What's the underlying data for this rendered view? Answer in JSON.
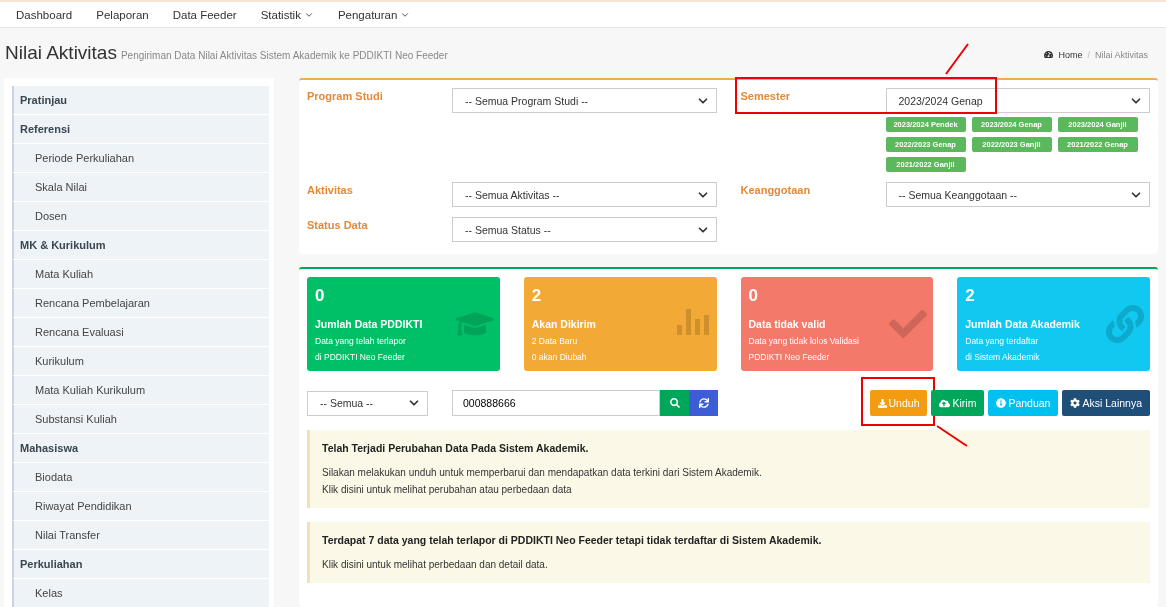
{
  "nav": [
    {
      "label": "Dashboard",
      "dropdown": false
    },
    {
      "label": "Pelaporan",
      "dropdown": false
    },
    {
      "label": "Data Feeder",
      "dropdown": false
    },
    {
      "label": "Statistik",
      "dropdown": true
    },
    {
      "label": "Pengaturan",
      "dropdown": true
    }
  ],
  "header": {
    "title": "Nilai Aktivitas",
    "subtitle": "Pengiriman Data Nilai Aktivitas Sistem Akademik ke PDDIKTI Neo Feeder"
  },
  "breadcrumb": {
    "separator": "/",
    "items": [
      "Home",
      "Nilai Aktivitas"
    ]
  },
  "sidebar": [
    {
      "label": "Pratinjau"
    },
    {
      "label": "Referensi",
      "children": [
        "Periode Perkuliahan",
        "Skala Nilai",
        "Dosen"
      ]
    },
    {
      "label": "MK & Kurikulum",
      "children": [
        "Mata Kuliah",
        "Rencana Pembelajaran",
        "Rencana Evaluasi",
        "Kurikulum",
        "Mata Kuliah Kurikulum",
        "Substansi Kuliah"
      ]
    },
    {
      "label": "Mahasiswa",
      "children": [
        "Biodata",
        "Riwayat Pendidikan",
        "Nilai Transfer"
      ]
    },
    {
      "label": "Perkuliahan",
      "children": [
        "Kelas"
      ]
    }
  ],
  "filters": [
    {
      "label": "Program Studi",
      "value": "-- Semua Program Studi --",
      "highlighted": false
    },
    {
      "label": "Semester",
      "value": "2023/2024 Genap",
      "highlighted": true,
      "chips": [
        "2023/2024 Pendek",
        "2023/2024 Genap",
        "2023/2024 Ganjil",
        "2022/2023 Genap",
        "2022/2023 Ganjil",
        "2021/2022 Genap",
        "2021/2022 Ganjil"
      ]
    },
    {
      "label": "Aktivitas",
      "value": "-- Semua Aktivitas --",
      "highlighted": false
    },
    {
      "label": "Keanggotaan",
      "value": "-- Semua Keanggotaan --",
      "highlighted": false
    },
    {
      "label": "Status Data",
      "value": "-- Semua Status --",
      "highlighted": false
    }
  ],
  "stats": [
    {
      "kind": "cap",
      "value": "0",
      "title": "Jumlah Data PDDIKTI",
      "lines": [
        "Data yang telah terlapor",
        "di PDDIKTI Neo Feeder"
      ],
      "color": "#00c067"
    },
    {
      "kind": "bars",
      "value": "2",
      "title": "Akan Dikirim",
      "lines": [
        "2 Data Baru",
        "0 akan Diubah"
      ],
      "color": "#f3a935"
    },
    {
      "kind": "check",
      "value": "0",
      "title": "Data tidak valid",
      "lines": [
        "Data yang tidak lolos Validasi",
        "PDDIKTI Neo Feeder"
      ],
      "color": "#f37a6a"
    },
    {
      "kind": "link",
      "value": "2",
      "title": "Jumlah Data Akademik",
      "lines": [
        "Data yang terdaftar",
        "di Sistem Akademik"
      ],
      "color": "#10c8f0"
    }
  ],
  "toolbar": {
    "filter": "-- Semua --",
    "search": "000888666"
  },
  "actions": [
    {
      "kind": "download",
      "label": "Unduh",
      "color": "#f39c12",
      "highlighted": true
    },
    {
      "kind": "upload",
      "label": "Kirim",
      "color": "#00a65a",
      "highlighted": false
    },
    {
      "kind": "info",
      "label": "Panduan",
      "color": "#00c0ef",
      "highlighted": false
    },
    {
      "kind": "gear",
      "label": "Aksi Lainnya",
      "color": "#1f4e79",
      "highlighted": false
    }
  ],
  "alerts": [
    {
      "title": "Telah Terjadi Perubahan Data Pada Sistem Akademik.",
      "lines": [
        "Silakan melakukan unduh untuk memperbarui dan mendapatkan data terkini dari Sistem Akademik.",
        "Klik disini untuk melihat perubahan atau perbedaan data"
      ]
    },
    {
      "title": "Terdapat 7 data yang telah terlapor di PDDIKTI Neo Feeder tetapi tidak terdaftar di Sistem Akademik.",
      "lines": [
        "Klik disini untuk melihat perbedaan dan detail data."
      ]
    }
  ]
}
